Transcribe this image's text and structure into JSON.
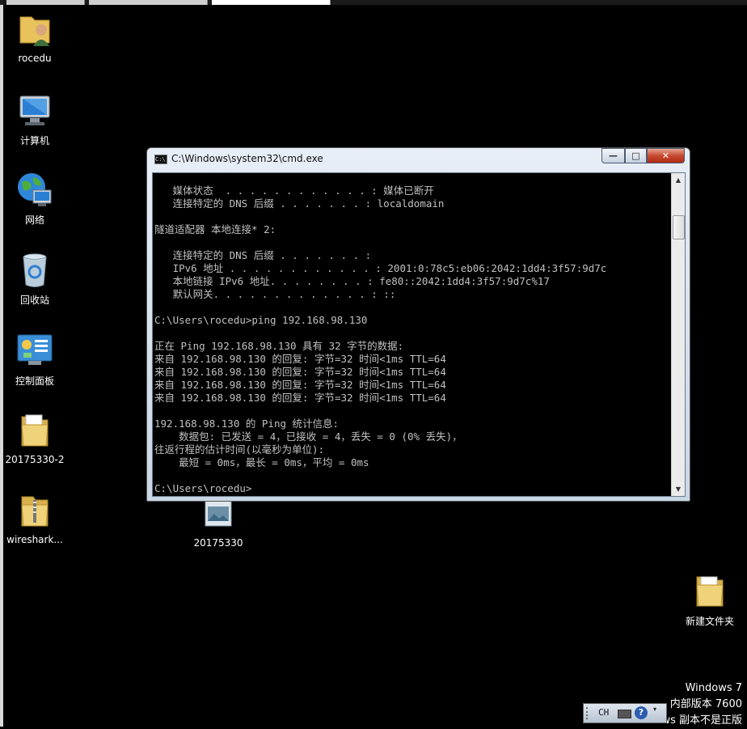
{
  "desktop": {
    "icons": [
      {
        "label": "rocedu",
        "icon": "user-folder-icon"
      },
      {
        "label": "计算机",
        "icon": "computer-icon"
      },
      {
        "label": "网络",
        "icon": "network-icon"
      },
      {
        "label": "回收站",
        "icon": "recycle-bin-icon"
      },
      {
        "label": "控制面板",
        "icon": "control-panel-icon"
      },
      {
        "label": "20175330-2",
        "icon": "folder-icon"
      },
      {
        "label": "wireshark...",
        "icon": "zip-folder-icon"
      },
      {
        "label": "20175330",
        "icon": "image-file-icon"
      },
      {
        "label": "新建文件夹",
        "icon": "folder-icon"
      }
    ]
  },
  "cmd_window": {
    "title": "C:\\Windows\\system32\\cmd.exe",
    "app_icon_text": "C:\\",
    "buttons": {
      "minimize": "—",
      "maximize": "□",
      "close": "✕"
    },
    "lines": [
      "   媒体状态  . . . . . . . . . . . . : 媒体已断开",
      "   连接特定的 DNS 后缀 . . . . . . . : localdomain",
      "",
      "隧道适配器 本地连接* 2:",
      "",
      "   连接特定的 DNS 后缀 . . . . . . . :",
      "   IPv6 地址 . . . . . . . . . . . . : 2001:0:78c5:eb06:2042:1dd4:3f57:9d7c",
      "   本地链接 IPv6 地址. . . . . . . . : fe80::2042:1dd4:3f57:9d7c%17",
      "   默认网关. . . . . . . . . . . . . : ::",
      "",
      "C:\\Users\\rocedu>ping 192.168.98.130",
      "",
      "正在 Ping 192.168.98.130 具有 32 字节的数据:",
      "来自 192.168.98.130 的回复: 字节=32 时间<1ms TTL=64",
      "来自 192.168.98.130 的回复: 字节=32 时间<1ms TTL=64",
      "来自 192.168.98.130 的回复: 字节=32 时间<1ms TTL=64",
      "来自 192.168.98.130 的回复: 字节=32 时间<1ms TTL=64",
      "",
      "192.168.98.130 的 Ping 统计信息:",
      "    数据包: 已发送 = 4，已接收 = 4，丢失 = 0 (0% 丢失)，",
      "往返行程的估计时间(以毫秒为单位):",
      "    最短 = 0ms，最长 = 0ms，平均 = 0ms",
      "",
      "C:\\Users\\rocedu>"
    ],
    "scroll_up": "▲",
    "scroll_down": "▼"
  },
  "watermark": {
    "line1": "Windows 7",
    "line2": "内部版本 7600",
    "line3": "ows 副本不是正版"
  },
  "language_bar": {
    "code": "CH",
    "help": "?",
    "options": "▾"
  }
}
